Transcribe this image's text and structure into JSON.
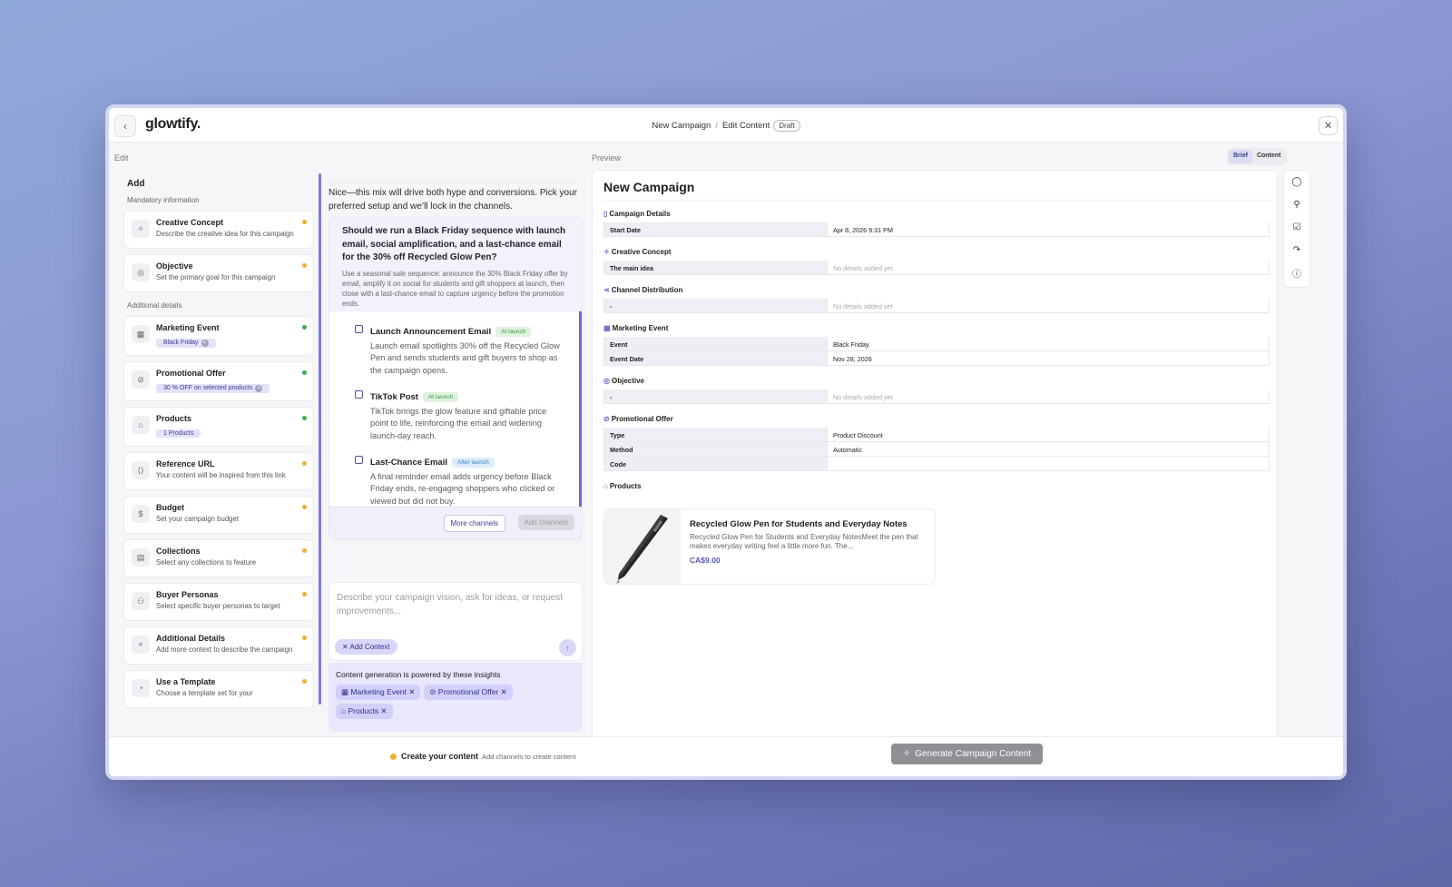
{
  "app": {
    "logo": "glowtify."
  },
  "header": {
    "crumb1": "New Campaign",
    "separator": "/",
    "crumb2": "Edit Content",
    "status": "Draft"
  },
  "sections": {
    "edit": "Edit",
    "preview": "Preview"
  },
  "view_toggle": {
    "brief": "Brief",
    "content": "Content",
    "active": "Brief"
  },
  "sidebar": {
    "add": "Add",
    "mandatory_label": "Mandatory information",
    "additional_label": "Additional details",
    "mandatory": [
      {
        "title": "Creative Concept",
        "desc": "Describe the creative idea for this campaign",
        "icon": "lightbulb-icon",
        "status": "pending"
      },
      {
        "title": "Objective",
        "desc": "Set the primary goal for this campaign",
        "icon": "target-icon",
        "status": "pending"
      }
    ],
    "additional": [
      {
        "title": "Marketing Event",
        "tag": "Black Friday",
        "icon": "calendar-icon",
        "status": "done"
      },
      {
        "title": "Promotional Offer",
        "tag": "30 % OFF on selected products",
        "icon": "percent-icon",
        "status": "done"
      },
      {
        "title": "Products",
        "tag": "1 Products",
        "icon": "tag-icon",
        "status": "done"
      },
      {
        "title": "Reference URL",
        "desc": "Your content will be inspired from this link",
        "icon": "link-icon",
        "status": "pending"
      },
      {
        "title": "Budget",
        "desc": "Set your campaign budget",
        "icon": "dollar-icon",
        "status": "pending"
      },
      {
        "title": "Collections",
        "desc": "Select any collections to feature",
        "icon": "archive-icon",
        "status": "pending"
      },
      {
        "title": "Buyer Personas",
        "desc": "Select specific buyer personas to target",
        "icon": "users-icon",
        "status": "pending"
      },
      {
        "title": "Additional Details",
        "desc": "Add more context to describe the campaign",
        "icon": "plus-icon",
        "status": "pending"
      },
      {
        "title": "Use a Template",
        "desc": "Choose a template set for your",
        "icon": "template-icon",
        "status": "pending"
      }
    ]
  },
  "chat": {
    "intro": "Nice—this mix will drive both hype and conversions. Pick your preferred setup and we’ll lock in the channels.",
    "question": "Should we run a Black Friday sequence with launch email, social amplification, and a last-chance email for the 30% off Recycled Glow Pen?",
    "question_desc": "Use a seasonal sale sequence: announce the 30% Black Friday offer by email, amplify it on social for students and gift shoppers at launch, then close with a last-chance email to capture urgency before the promotion ends.",
    "options": [
      {
        "title": "Launch Announcement Email",
        "badge": "At launch",
        "badge_type": "green",
        "desc": "Launch email spotlights 30% off the Recycled Glow Pen and sends students and gift buyers to shop as the campaign opens."
      },
      {
        "title": "TikTok Post",
        "badge": "At launch",
        "badge_type": "green",
        "desc": "TikTok brings the glow feature and giftable price point to life, reinforcing the email and widening launch-day reach."
      },
      {
        "title": "Last-Chance Email",
        "badge": "After launch",
        "badge_type": "blue",
        "desc": "A final reminder email adds urgency before Black Friday ends, re-engaging shoppers who clicked or viewed but did not buy."
      }
    ],
    "more_channels": "More channels",
    "add_channels": "Add channels",
    "composer_placeholder": "Describe your campaign vision, ask for ideas, or request improvements...",
    "add_context": "Add Context",
    "insights_title": "Content generation is powered by these insights",
    "insights": [
      "Marketing Event",
      "Promotional Offer",
      "Products"
    ]
  },
  "preview": {
    "title": "New Campaign",
    "campaign_details": {
      "heading": "Campaign Details",
      "rows": [
        [
          "Start Date",
          "Apr 8, 2026 9:31 PM"
        ]
      ]
    },
    "creative_concept": {
      "heading": "Creative Concept",
      "rows": [
        [
          "The main idea",
          "No details added yet"
        ]
      ]
    },
    "channel_distribution": {
      "heading": "Channel Distribution",
      "rows": [
        [
          "-",
          "No details added yet"
        ]
      ]
    },
    "marketing_event": {
      "heading": "Marketing Event",
      "rows": [
        [
          "Event",
          "Black Friday"
        ],
        [
          "Event Date",
          "Nov 28, 2026"
        ]
      ]
    },
    "objective": {
      "heading": "Objective",
      "rows": [
        [
          "-",
          "No details added yet"
        ]
      ]
    },
    "promotional_offer": {
      "heading": "Promotional Offer",
      "rows": [
        [
          "Type",
          "Product Discount"
        ],
        [
          "Method",
          "Automatic"
        ],
        [
          "Code",
          ""
        ]
      ]
    },
    "products": {
      "heading": "Products",
      "name": "Recycled Glow Pen for Students and Everyday Notes",
      "desc": "Recycled Glow Pen for Students and Everyday NotesMeet the pen that makes everyday writing feel a little more fun. The...",
      "price": "CA$9.00"
    }
  },
  "footer": {
    "status_title": "Create your content",
    "status_sub": "Add channels to create content",
    "generate": "Generate Campaign Content"
  }
}
